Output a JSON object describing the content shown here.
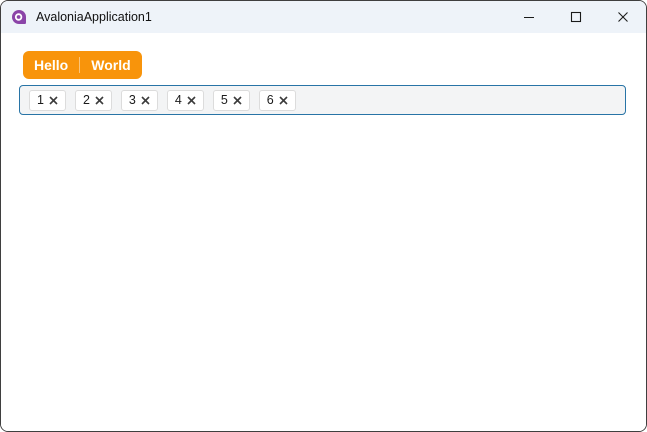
{
  "window": {
    "title": "AvaloniaApplication1",
    "controls": {
      "minimize_icon": "minimize-dash",
      "maximize_icon": "maximize-square",
      "close_icon": "close-cross"
    }
  },
  "tabs": {
    "items": [
      {
        "label": "Hello"
      },
      {
        "label": "World"
      }
    ]
  },
  "tag_input": {
    "items": [
      {
        "label": "1"
      },
      {
        "label": "2"
      },
      {
        "label": "3"
      },
      {
        "label": "4"
      },
      {
        "label": "5"
      },
      {
        "label": "6"
      }
    ],
    "remove_icon": "x-cross"
  },
  "colors": {
    "accent_orange": "#F8940B",
    "focus_border_blue": "#2874A6",
    "titlebar_bg": "#EEF3F9",
    "logo_purple": "#8B44A8",
    "field_bg": "#F3F4F5"
  }
}
